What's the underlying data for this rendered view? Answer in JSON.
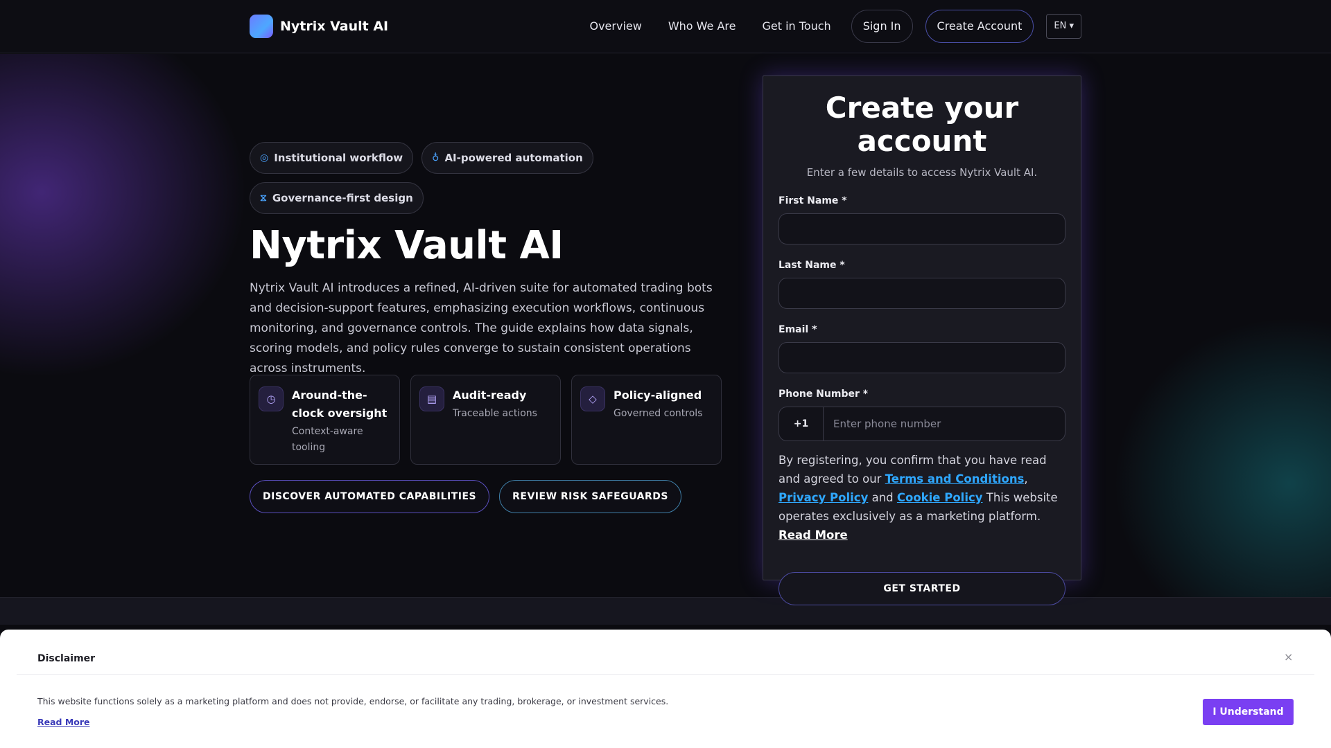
{
  "nav": {
    "brand": "Nytrix Vault AI",
    "links": [
      "Overview",
      "Who We Are",
      "Get in Touch"
    ],
    "sign_in": "Sign In",
    "create_account": "Create Account",
    "language": "EN ▾"
  },
  "hero": {
    "tags": [
      {
        "icon": "check-circle-icon",
        "label": "Institutional workflow"
      },
      {
        "icon": "lightbulb-icon",
        "label": "AI-powered automation"
      },
      {
        "icon": "hourglass-icon",
        "label": "Governance-first design"
      }
    ],
    "title": "Nytrix Vault AI",
    "description": "Nytrix Vault AI introduces a refined, AI-driven suite for automated trading bots and decision-support features, emphasizing execution workflows, continuous monitoring, and governance controls. The guide explains how data signals, scoring models, and policy rules converge to sustain consistent operations across instruments.",
    "features": [
      {
        "icon": "clock-icon",
        "title": "Around-the-clock oversight",
        "subtitle": "Context-aware tooling"
      },
      {
        "icon": "document-icon",
        "title": "Audit-ready",
        "subtitle": "Traceable actions"
      },
      {
        "icon": "diamond-icon",
        "title": "Policy-aligned",
        "subtitle": "Governed controls"
      }
    ],
    "cta_primary": "DISCOVER AUTOMATED CAPABILITIES",
    "cta_secondary": "REVIEW RISK SAFEGUARDS"
  },
  "form": {
    "title": "Create your account",
    "subtitle": "Enter a few details to access Nytrix Vault AI.",
    "first_name_label": "First Name *",
    "last_name_label": "Last Name *",
    "email_label": "Email *",
    "phone_label": "Phone Number *",
    "phone_code": "+1",
    "phone_placeholder": "Enter phone number",
    "consent_1": "By registering, you confirm that you have read and agreed to our ",
    "terms": "Terms and Conditions",
    "comma": ", ",
    "privacy": "Privacy Policy",
    "and": " and ",
    "cookie": "Cookie Policy",
    "consent_2": " This website operates exclusively as a marketing platform. ",
    "read_more": "Read More",
    "submit": "GET STARTED"
  },
  "disclaimer": {
    "title": "Disclaimer",
    "close": "×",
    "text": "This website functions solely as a marketing platform and does not provide, endorse, or facilitate any trading, brokerage, or investment services.",
    "read_more": "Read More",
    "button": "I Understand"
  },
  "colors": {
    "background": "#0b0b10",
    "accent_purple": "#7a3ff2",
    "link_blue": "#2fa8ff"
  }
}
